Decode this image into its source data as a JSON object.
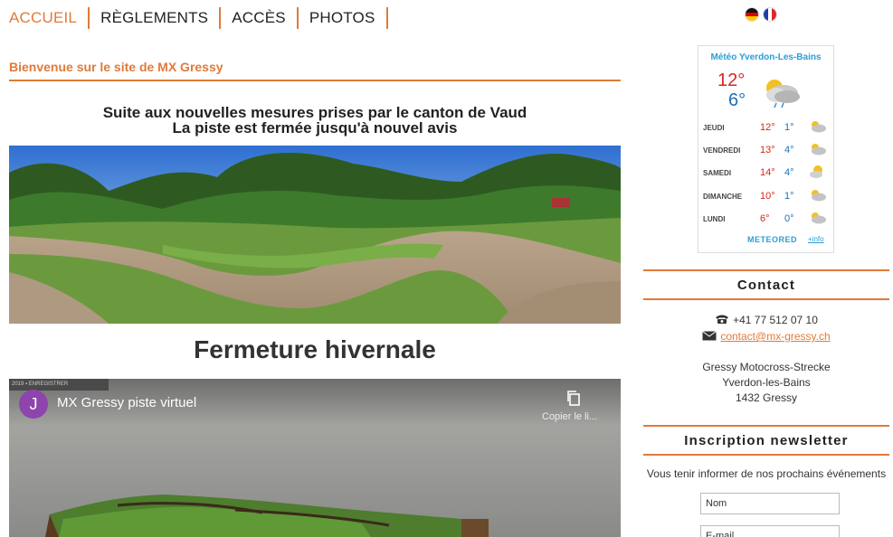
{
  "nav": {
    "items": [
      {
        "label": "ACCUEIL"
      },
      {
        "label": "RÈGLEMENTS"
      },
      {
        "label": "ACCÈS"
      },
      {
        "label": "PHOTOS"
      }
    ]
  },
  "languages": {
    "de_icon": "flag-germany",
    "fr_icon": "flag-france"
  },
  "main": {
    "welcome": "Bienvenue sur le site de MX Gressy",
    "notice_line1": "Suite aux nouvelles mesures prises par le canton de Vaud",
    "notice_line2": "La piste est fermée jusqu'à nouvel avis",
    "closure_title": "Fermeture hivernale"
  },
  "video": {
    "strip_text": "2019 ▪  ENREGISTRER",
    "avatar_letter": "J",
    "title": "MX Gressy piste virtuel",
    "copy_label": "Copier le li..."
  },
  "weather": {
    "title": "Météo Yverdon-Les-Bains",
    "today_max": "12°",
    "today_min": "6°",
    "forecast": [
      {
        "day": "JEUDI",
        "max": "12°",
        "min": "1°"
      },
      {
        "day": "VENDREDI",
        "max": "13°",
        "min": "4°"
      },
      {
        "day": "SAMEDI",
        "max": "14°",
        "min": "4°"
      },
      {
        "day": "DIMANCHE",
        "max": "10°",
        "min": "1°"
      },
      {
        "day": "LUNDI",
        "max": "6°",
        "min": "0°"
      }
    ],
    "brand": "METEORED",
    "more": "+info"
  },
  "contact": {
    "heading": "Contact",
    "phone": "+41 77 512 07 10",
    "email": "contact@mx-gressy.ch",
    "address_line1": "Gressy Motocross-Strecke",
    "address_line2": "Yverdon-les-Bains",
    "address_line3": "1432 Gressy"
  },
  "newsletter": {
    "heading": "Inscription newsletter",
    "text": "Vous tenir informer de nos prochains événements",
    "name_placeholder": "Nom",
    "email_placeholder": "E-mail"
  },
  "colors": {
    "accent": "#e07a3a",
    "weather_blue": "#2a9fd6",
    "temp_max": "#d9261c",
    "temp_min": "#1e6fb8"
  }
}
